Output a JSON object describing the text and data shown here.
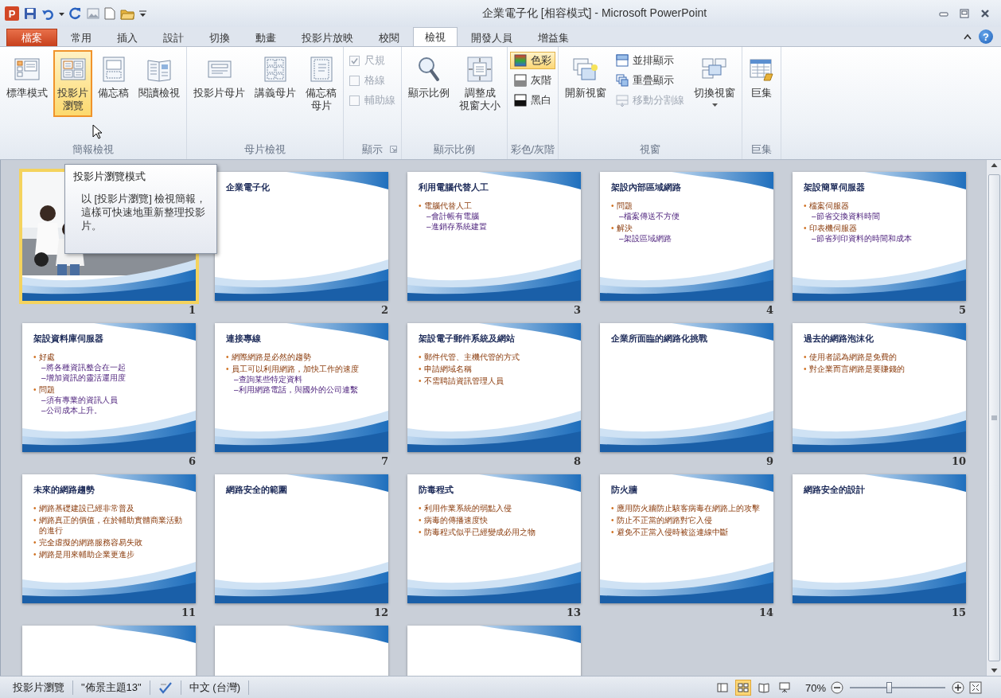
{
  "window": {
    "app_icon": "P",
    "title": "企業電子化 [相容模式] - Microsoft PowerPoint"
  },
  "tabs": [
    {
      "label": "檔案",
      "kind": "file",
      "selected": false
    },
    {
      "label": "常用",
      "kind": "tab",
      "selected": false
    },
    {
      "label": "插入",
      "kind": "tab",
      "selected": false
    },
    {
      "label": "設計",
      "kind": "tab",
      "selected": false
    },
    {
      "label": "切換",
      "kind": "tab",
      "selected": false
    },
    {
      "label": "動畫",
      "kind": "tab",
      "selected": false
    },
    {
      "label": "投影片放映",
      "kind": "tab",
      "selected": false
    },
    {
      "label": "校閱",
      "kind": "tab",
      "selected": false
    },
    {
      "label": "檢視",
      "kind": "tab",
      "selected": true
    },
    {
      "label": "開發人員",
      "kind": "tab",
      "selected": false
    },
    {
      "label": "增益集",
      "kind": "tab",
      "selected": false
    }
  ],
  "help": "?",
  "ribbon": [
    {
      "label": "簡報檢視",
      "items": [
        {
          "kind": "large",
          "lines": [
            "標準模式"
          ],
          "selected": false
        },
        {
          "kind": "large",
          "lines": [
            "投影片",
            "瀏覽"
          ],
          "selected": true
        },
        {
          "kind": "large",
          "lines": [
            "備忘稿"
          ],
          "selected": false
        },
        {
          "kind": "large",
          "lines": [
            "閱讀檢視"
          ],
          "selected": false
        }
      ]
    },
    {
      "label": "母片檢視",
      "items": [
        {
          "kind": "large",
          "lines": [
            "投影片母片"
          ],
          "selected": false
        },
        {
          "kind": "large",
          "lines": [
            "講義母片"
          ],
          "selected": false
        },
        {
          "kind": "large",
          "lines": [
            "備忘稿",
            "母片"
          ],
          "selected": false
        }
      ]
    },
    {
      "label": "顯示",
      "items": [
        {
          "kind": "stack",
          "items": [
            {
              "kind": "check",
              "label": "尺規",
              "checked": true,
              "disabled": true
            },
            {
              "kind": "check",
              "label": "格線",
              "checked": false,
              "disabled": true
            },
            {
              "kind": "check",
              "label": "輔助線",
              "checked": false,
              "disabled": true
            }
          ]
        }
      ]
    },
    {
      "label": "顯示比例",
      "items": [
        {
          "kind": "large",
          "lines": [
            "顯示比例"
          ],
          "selected": false
        },
        {
          "kind": "large",
          "lines": [
            "調整成",
            "視窗大小"
          ],
          "selected": false
        }
      ]
    },
    {
      "label": "彩色/灰階",
      "items": [
        {
          "kind": "stack",
          "items": [
            {
              "kind": "small",
              "label": "色彩",
              "selected": true,
              "disabled": false
            },
            {
              "kind": "small",
              "label": "灰階",
              "selected": false,
              "disabled": false
            },
            {
              "kind": "small",
              "label": "黑白",
              "selected": false,
              "disabled": false
            }
          ]
        }
      ]
    },
    {
      "label": "視窗",
      "items": [
        {
          "kind": "large",
          "lines": [
            "開新視窗"
          ],
          "selected": false
        },
        {
          "kind": "stack",
          "items": [
            {
              "kind": "small",
              "label": "並排顯示",
              "selected": false,
              "disabled": false
            },
            {
              "kind": "small",
              "label": "重疊顯示",
              "selected": false,
              "disabled": false
            },
            {
              "kind": "small",
              "label": "移動分割線",
              "selected": false,
              "disabled": true
            }
          ]
        },
        {
          "kind": "large",
          "lines": [
            "切換視窗"
          ],
          "selected": false,
          "dropdown": true
        }
      ]
    },
    {
      "label": "巨集",
      "items": [
        {
          "kind": "large",
          "lines": [
            "巨集"
          ],
          "selected": false
        }
      ]
    }
  ],
  "slides": [
    {
      "number": "1",
      "selected": true
    },
    {
      "number": "2",
      "kind": "text",
      "selected": false,
      "title": "企業電子化"
    },
    {
      "number": "3",
      "kind": "text",
      "selected": false,
      "title": "利用電腦代替人工",
      "bullets": [
        {
          "bullet": "•",
          "text": "電腦代替人工",
          "children": [
            {
              "text": "–會計帳有電腦"
            },
            {
              "text": "–進銷存系統建置"
            }
          ]
        }
      ]
    },
    {
      "number": "4",
      "kind": "text",
      "selected": false,
      "title": "架設內部區域網路",
      "bullets": [
        {
          "bullet": "•",
          "text": "問題",
          "children": [
            {
              "text": "–檔案傳送不方便"
            }
          ]
        },
        {
          "bullet": "•",
          "text": "解決",
          "children": [
            {
              "text": "–架設區域網路"
            }
          ]
        }
      ]
    },
    {
      "number": "5",
      "kind": "text",
      "selected": false,
      "title": "架設簡單伺服器",
      "bullets": [
        {
          "bullet": "•",
          "text": "檔案伺服器",
          "children": [
            {
              "text": "–節省交換資料時間"
            }
          ]
        },
        {
          "bullet": "•",
          "text": "印表機伺服器",
          "children": [
            {
              "text": "–節省列印資料的時間和成本"
            }
          ]
        }
      ]
    },
    {
      "number": "6",
      "kind": "text",
      "selected": false,
      "title": "架設資料庫伺服器",
      "bullets": [
        {
          "bullet": "•",
          "text": "好處",
          "children": [
            {
              "text": "–將各種資訊整合在一起"
            },
            {
              "text": "–增加資訊的靈活運用度"
            }
          ]
        },
        {
          "bullet": "•",
          "text": "問題",
          "children": [
            {
              "text": "–須有專業的資訊人員"
            },
            {
              "text": "–公司成本上升。"
            }
          ]
        }
      ]
    },
    {
      "number": "7",
      "kind": "text",
      "selected": false,
      "title": "連接專線",
      "bullets": [
        {
          "bullet": "•",
          "text": "網際網路是必然的趨勢"
        },
        {
          "bullet": "•",
          "text": "員工可以利用網路，加快工作的速度",
          "children": [
            {
              "text": "–查詢某些特定資料"
            },
            {
              "text": "–利用網路電話，與國外的公司連繫"
            }
          ]
        }
      ]
    },
    {
      "number": "8",
      "kind": "text",
      "selected": false,
      "title": "架設電子郵件系統及網站",
      "bullets": [
        {
          "bullet": "•",
          "text": "郵件代管、主機代管的方式"
        },
        {
          "bullet": "•",
          "text": "申請網域名稱"
        },
        {
          "bullet": "•",
          "text": "不需聘請資訊管理人員"
        }
      ]
    },
    {
      "number": "9",
      "kind": "text",
      "selected": false,
      "title": "企業所面臨的網路化挑戰"
    },
    {
      "number": "10",
      "kind": "text",
      "selected": false,
      "title": "過去的網路泡沫化",
      "bullets": [
        {
          "bullet": "•",
          "text": "使用者認為網路是免費的"
        },
        {
          "bullet": "•",
          "text": "對企業而言網路是要賺錢的"
        }
      ]
    },
    {
      "number": "11",
      "kind": "text",
      "selected": false,
      "title": "未來的網路趨勢",
      "bullets": [
        {
          "bullet": "•",
          "text": "網路基礎建設已經非常普及"
        },
        {
          "bullet": "•",
          "text": "網路真正的價值，在於輔助實體商業活動的進行"
        },
        {
          "bullet": "•",
          "text": "完全虛擬的網路服務容易失敗"
        },
        {
          "bullet": "•",
          "text": "網路是用來輔助企業更進步"
        }
      ]
    },
    {
      "number": "12",
      "kind": "text",
      "selected": false,
      "title": "網路安全的範圍"
    },
    {
      "number": "13",
      "kind": "text",
      "selected": false,
      "title": "防毒程式",
      "bullets": [
        {
          "bullet": "•",
          "text": "利用作業系統的弱點入侵"
        },
        {
          "bullet": "•",
          "text": "病毒的傳播速度快"
        },
        {
          "bullet": "•",
          "text": "防毒程式似乎已經變成必用之物"
        }
      ]
    },
    {
      "number": "14",
      "kind": "text",
      "selected": false,
      "title": "防火牆",
      "bullets": [
        {
          "bullet": "•",
          "text": "應用防火牆防止駭客病毒在網路上的攻擊"
        },
        {
          "bullet": "•",
          "text": "防止不正當的網路對它入侵"
        },
        {
          "bullet": "•",
          "text": "避免不正當入侵時被盜連線中斷"
        }
      ]
    },
    {
      "number": "15",
      "kind": "text",
      "selected": false,
      "title": "網路安全的設計"
    },
    {
      "kind": "blank",
      "selected": false
    },
    {
      "kind": "blank",
      "selected": false
    },
    {
      "kind": "blank",
      "selected": false
    }
  ],
  "tooltip": {
    "title": "投影片瀏覽模式",
    "body": "以 [投影片瀏覽] 檢視簡報，這樣可快速地重新整理投影片。"
  },
  "status_bar": {
    "items": [
      {
        "kind": "text",
        "label": "投影片瀏覽"
      },
      {
        "kind": "text",
        "label": "\"佈景主題13\""
      },
      {
        "kind": "spellcheck"
      },
      {
        "kind": "text",
        "label": "中文 (台灣)"
      }
    ],
    "views": [
      {
        "selected": false
      },
      {
        "selected": true
      },
      {
        "selected": false
      },
      {
        "selected": false
      }
    ],
    "zoom": {
      "label": "70%",
      "level": 0.42
    }
  }
}
